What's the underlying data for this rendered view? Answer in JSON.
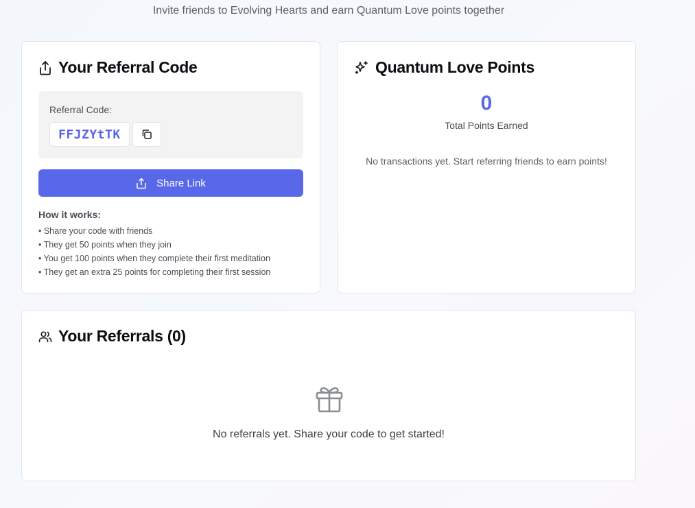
{
  "header": {
    "subtitle": "Invite friends to Evolving Hearts and earn Quantum Love points together"
  },
  "referral_card": {
    "title": "Your Referral Code",
    "code_label": "Referral Code:",
    "code": "FFJZYtTK",
    "share_label": "Share Link",
    "how_title": "How it works:",
    "how_items": [
      "• Share your code with friends",
      "• They get 50 points when they join",
      "• You get 100 points when they complete their first meditation",
      "• They get an extra 25 points for completing their first session"
    ]
  },
  "points_card": {
    "title": "Quantum Love Points",
    "total": "0",
    "total_label": "Total Points Earned",
    "empty_text": "No transactions yet. Start referring friends to earn points!"
  },
  "referrals_card": {
    "title": "Your Referrals (0)",
    "empty_text": "No referrals yet. Share your code to get started!"
  },
  "colors": {
    "accent": "#5968e8",
    "background": "#f4f8fc"
  },
  "icons": [
    "share-icon",
    "sparkles-icon",
    "copy-icon",
    "users-icon",
    "gift-icon"
  ]
}
